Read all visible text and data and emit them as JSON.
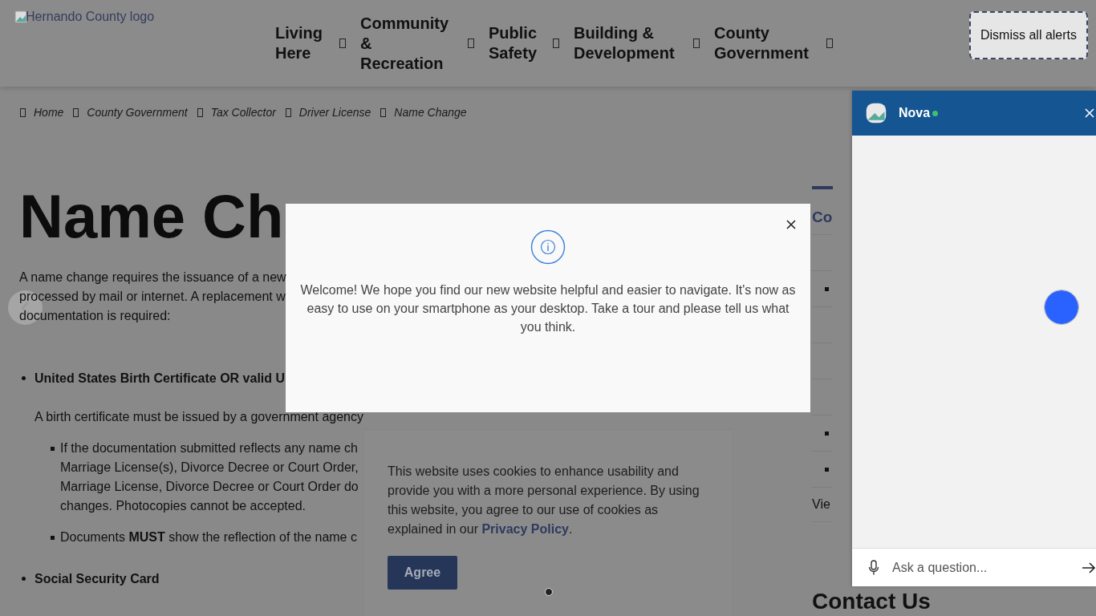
{
  "header": {
    "logo_alt": "Hernando County logo",
    "nav": [
      {
        "label": "Living Here"
      },
      {
        "label": "Community & Recreation"
      },
      {
        "label": "Public Safety"
      },
      {
        "label": "Building & Development"
      },
      {
        "label": "County Government"
      }
    ],
    "dismiss_button": "Dismiss all alerts"
  },
  "breadcrumb": [
    "Home",
    "County Government",
    "Tax Collector",
    "Driver License",
    "Name Change"
  ],
  "page": {
    "title": "Name Ch",
    "intro_lines": [
      "A name change requires the issuance of a new",
      "processed by mail or internet. A replacement w",
      "documentation is required:"
    ],
    "items": [
      {
        "heading": "United States Birth Certificate OR valid U",
        "note": "A birth certificate must be issued by a government agency",
        "subitems": [
          {
            "lines": [
              "If the documentation submitted reflects any name ch",
              "Marriage License(s), Divorce Decree or Court Order,",
              "Marriage License, Divorce Decree or Court Order do",
              "changes. Photocopies cannot be accepted."
            ]
          },
          {
            "lines": [
              "Documents **MUST** show the reflection of the name c"
            ]
          }
        ]
      },
      {
        "heading": "Social Security Card"
      }
    ]
  },
  "sidebar": {
    "heading": "Co",
    "link": "Vie",
    "rows": [
      {
        "bullet": false
      },
      {
        "bullet": true
      },
      {
        "bullet": false
      },
      {
        "bullet": false
      },
      {
        "bullet": false
      },
      {
        "bullet": true
      },
      {
        "bullet": true
      }
    ],
    "contact_heading": "Contact Us"
  },
  "welcome_dialog": {
    "message": "Welcome! We hope you find our new website helpful and easier to navigate. It's now as easy to use on your smartphone as your desktop. Take a tour and please tell us what you think."
  },
  "cookie_banner": {
    "text_before": "This website uses cookies to enhance usability and provide you with a more personal experience. By using this website, you agree to our use of cookies as explained in our",
    "link": "Privacy Policy",
    "text_after": ".",
    "button": "Agree"
  },
  "chat": {
    "name": "Nova",
    "online": true,
    "placeholder": "Ask a question..."
  }
}
